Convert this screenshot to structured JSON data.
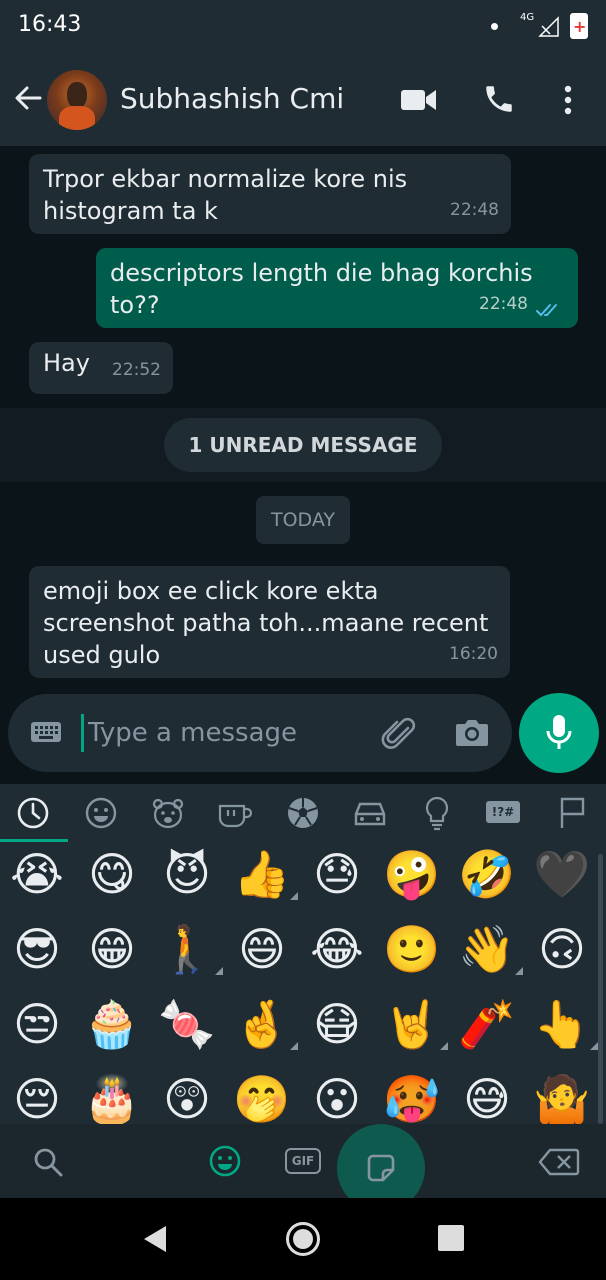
{
  "status_bar": {
    "time": "16:43",
    "network": "4G",
    "roaming": "R"
  },
  "header": {
    "contact_name": "Subhashish Cmi"
  },
  "messages": [
    {
      "direction": "in",
      "text": "Trpor ekbar normalize kore nis histogram ta k",
      "time": "22:48"
    },
    {
      "direction": "out",
      "text": "descriptors length die bhag korchis to??",
      "time": "22:48",
      "status": "read"
    },
    {
      "direction": "in",
      "text": "Hay",
      "time": "22:52"
    },
    {
      "direction": "in",
      "text": "emoji box ee click kore ekta screenshot patha toh...maane recent used gulo",
      "time": "16:20"
    }
  ],
  "unread_banner": "1 UNREAD MESSAGE",
  "date_divider": "TODAY",
  "composer": {
    "placeholder": "Type a message"
  },
  "emoji_panel": {
    "categories": [
      "recent",
      "smileys",
      "animals",
      "food",
      "activity",
      "travel",
      "objects",
      "symbols",
      "flags"
    ],
    "selected_category": "recent",
    "symbols_label": "!?#",
    "gif_label": "GIF",
    "recent_emojis": [
      [
        "😭",
        "😋",
        "😈",
        "👍",
        "😓",
        "🤪",
        "🤣",
        "🖤"
      ],
      [
        "😎",
        "😁",
        "🚶",
        "😄",
        "😂",
        "🙂",
        "👋",
        "🙃"
      ],
      [
        "😒",
        "🧁",
        "🍬",
        "🤞",
        "😷",
        "🤘",
        "🧨",
        "👆"
      ],
      [
        "😔",
        "🎂",
        "😲",
        "🤭",
        "😮",
        "🥵",
        "😅",
        "🤷"
      ]
    ]
  },
  "colors": {
    "accent": "#00a884",
    "outgoing_bubble": "#005c4b",
    "incoming_bubble": "#1f2c34",
    "header": "#1f2c34",
    "background": "#0b1418"
  }
}
